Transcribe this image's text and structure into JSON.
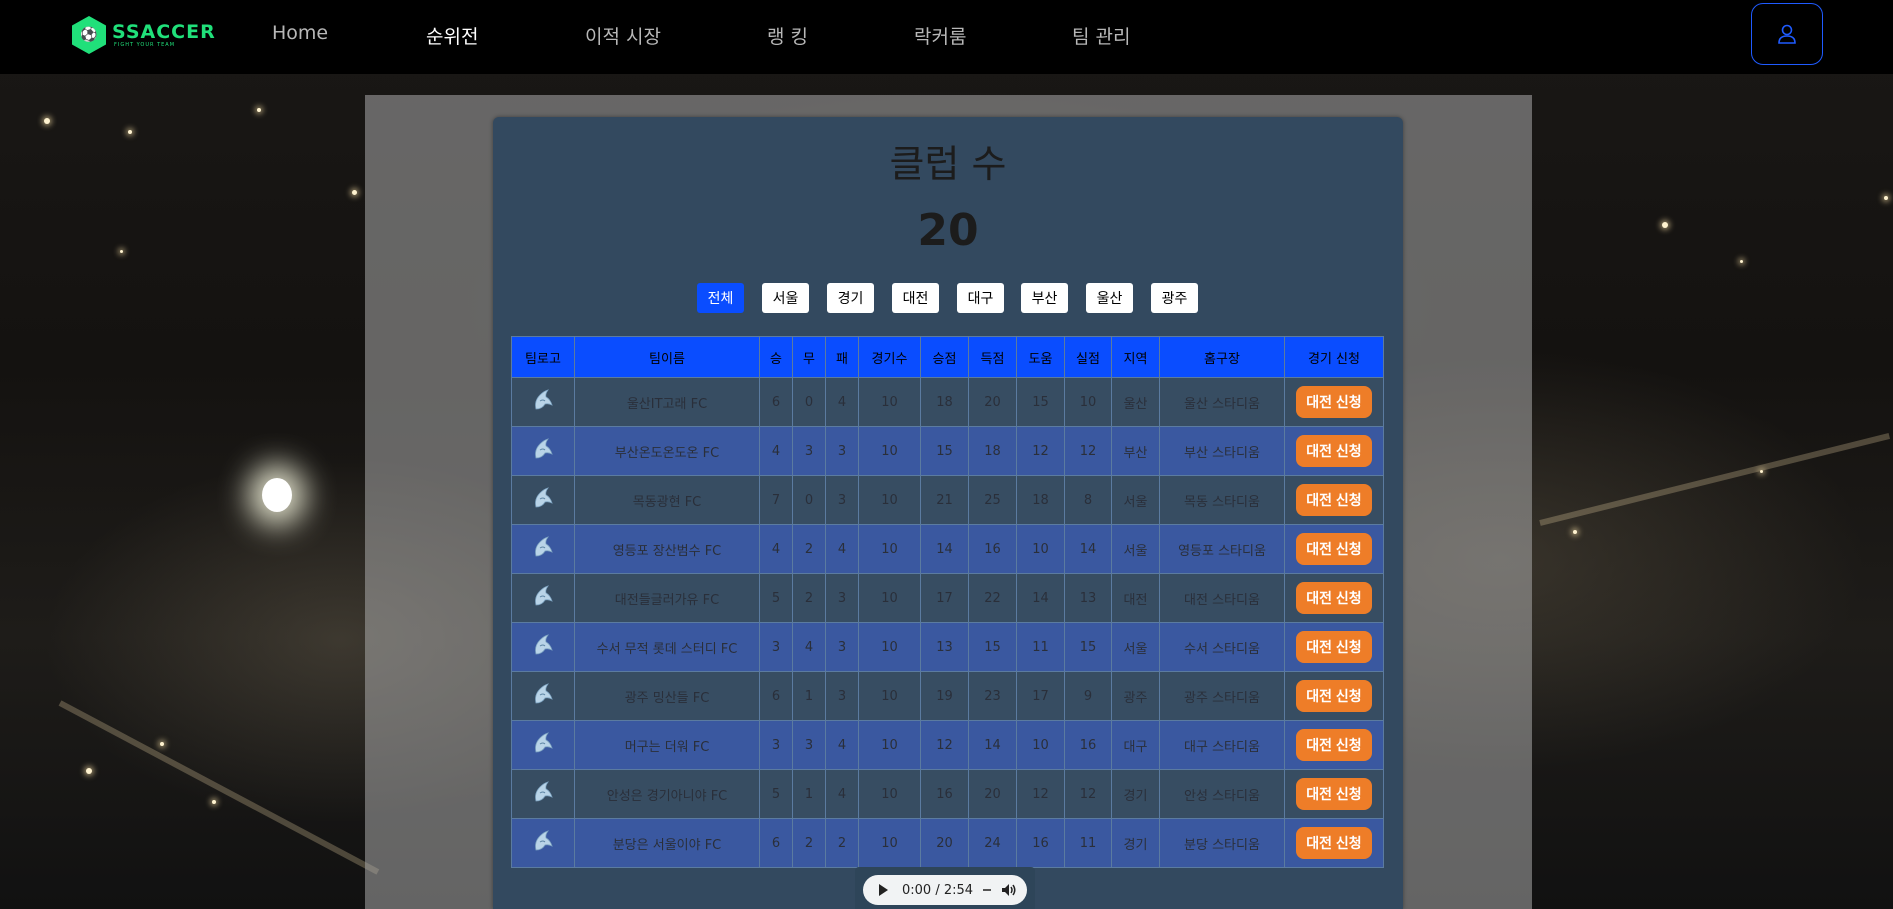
{
  "app": {
    "logo_main": "SSACCER",
    "logo_sub": "FIGHT YOUR TEAM"
  },
  "nav": {
    "items": [
      {
        "label": "Home"
      },
      {
        "label": "순위전"
      },
      {
        "label": "이적 시장"
      },
      {
        "label": "랭 킹"
      },
      {
        "label": "락커룸"
      },
      {
        "label": "팀 관리"
      }
    ],
    "active": "순위전",
    "user_icon": "user-icon"
  },
  "summary": {
    "title": "클럽 수",
    "count": "20"
  },
  "filters": {
    "items": [
      "전체",
      "서울",
      "경기",
      "대전",
      "대구",
      "부산",
      "울산",
      "광주"
    ],
    "active": "전체"
  },
  "table": {
    "headers": [
      "팀로고",
      "팀이름",
      "승",
      "무",
      "패",
      "경기수",
      "승점",
      "득점",
      "도움",
      "실점",
      "지역",
      "홈구장",
      "경기 신청"
    ],
    "rows": [
      {
        "name": "울산IT고래 FC",
        "w": "6",
        "d": "0",
        "l": "4",
        "games": "10",
        "pts": "18",
        "gf": "20",
        "ast": "15",
        "ga": "10",
        "region": "울산",
        "stadium": "울산 스타디움",
        "action": "대전 신청"
      },
      {
        "name": "부산온도온도온 FC",
        "w": "4",
        "d": "3",
        "l": "3",
        "games": "10",
        "pts": "15",
        "gf": "18",
        "ast": "12",
        "ga": "12",
        "region": "부산",
        "stadium": "부산 스타디움",
        "action": "대전 신청"
      },
      {
        "name": "목동광현 FC",
        "w": "7",
        "d": "0",
        "l": "3",
        "games": "10",
        "pts": "21",
        "gf": "25",
        "ast": "18",
        "ga": "8",
        "region": "서울",
        "stadium": "목동 스타디움",
        "action": "대전 신청"
      },
      {
        "name": "영등포 장산범수 FC",
        "w": "4",
        "d": "2",
        "l": "4",
        "games": "10",
        "pts": "14",
        "gf": "16",
        "ast": "10",
        "ga": "14",
        "region": "서울",
        "stadium": "영등포 스타디움",
        "action": "대전 신청"
      },
      {
        "name": "대전들글러가유 FC",
        "w": "5",
        "d": "2",
        "l": "3",
        "games": "10",
        "pts": "17",
        "gf": "22",
        "ast": "14",
        "ga": "13",
        "region": "대전",
        "stadium": "대전 스타디움",
        "action": "대전 신청"
      },
      {
        "name": "수서 무적 롯데 스터디 FC",
        "w": "3",
        "d": "4",
        "l": "3",
        "games": "10",
        "pts": "13",
        "gf": "15",
        "ast": "11",
        "ga": "15",
        "region": "서울",
        "stadium": "수서 스타디움",
        "action": "대전 신청"
      },
      {
        "name": "광주 밍산들 FC",
        "w": "6",
        "d": "1",
        "l": "3",
        "games": "10",
        "pts": "19",
        "gf": "23",
        "ast": "17",
        "ga": "9",
        "region": "광주",
        "stadium": "광주 스타디움",
        "action": "대전 신청"
      },
      {
        "name": "머구는 더워 FC",
        "w": "3",
        "d": "3",
        "l": "4",
        "games": "10",
        "pts": "12",
        "gf": "14",
        "ast": "10",
        "ga": "16",
        "region": "대구",
        "stadium": "대구 스타디움",
        "action": "대전 신청"
      },
      {
        "name": "안성은 경기아니야 FC",
        "w": "5",
        "d": "1",
        "l": "4",
        "games": "10",
        "pts": "16",
        "gf": "20",
        "ast": "12",
        "ga": "12",
        "region": "경기",
        "stadium": "안성 스타디움",
        "action": "대전 신청"
      },
      {
        "name": "분당은 서울이야 FC",
        "w": "6",
        "d": "2",
        "l": "2",
        "games": "10",
        "pts": "20",
        "gf": "24",
        "ast": "16",
        "ga": "11",
        "region": "경기",
        "stadium": "분당 스타디움",
        "action": "대전 신청"
      }
    ]
  },
  "audio": {
    "time": "0:00 / 2:54"
  },
  "colors": {
    "brand": "#20e07a",
    "accent": "#0a4dff",
    "apply": "#ee7d28",
    "card": "#33495f"
  }
}
